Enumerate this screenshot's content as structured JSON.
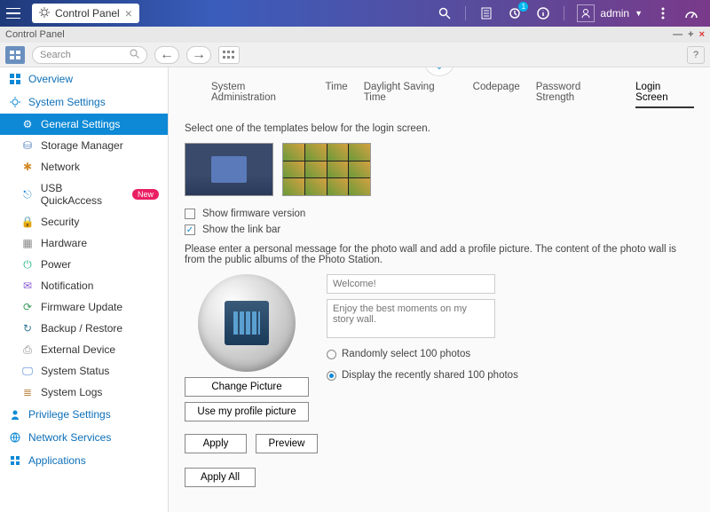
{
  "topbar": {
    "tab_label": "Control Panel",
    "user": "admin",
    "notif_badge": "1"
  },
  "window": {
    "title": "Control Panel"
  },
  "toolbar": {
    "search_placeholder": "Search"
  },
  "sidebar": {
    "cats": [
      {
        "label": "Overview"
      },
      {
        "label": "System Settings",
        "items": [
          {
            "label": "General Settings",
            "active": true
          },
          {
            "label": "Storage Manager"
          },
          {
            "label": "Network"
          },
          {
            "label": "USB QuickAccess",
            "new": "New"
          },
          {
            "label": "Security"
          },
          {
            "label": "Hardware"
          },
          {
            "label": "Power"
          },
          {
            "label": "Notification"
          },
          {
            "label": "Firmware Update"
          },
          {
            "label": "Backup / Restore"
          },
          {
            "label": "External Device"
          },
          {
            "label": "System Status"
          },
          {
            "label": "System Logs"
          }
        ]
      },
      {
        "label": "Privilege Settings"
      },
      {
        "label": "Network Services"
      },
      {
        "label": "Applications"
      }
    ]
  },
  "tabs": {
    "t0": "System Administration",
    "t1": "Time",
    "t2": "Daylight Saving Time",
    "t3": "Codepage",
    "t4": "Password Strength",
    "t5": "Login Screen"
  },
  "content": {
    "template_desc": "Select one of the templates below for the login screen.",
    "check_firmware": "Show firmware version",
    "check_linkbar": "Show the link bar",
    "msg_desc": "Please enter a personal message for the photo wall and add a profile picture. The content of the photo wall is from the public albums of the Photo Station.",
    "welcome_placeholder": "Welcome!",
    "story_placeholder": "Enjoy the best moments on my story wall.",
    "radio_random": "Randomly select 100 photos",
    "radio_recent": "Display the recently shared 100 photos",
    "btn_change": "Change Picture",
    "btn_usemy": "Use my profile picture",
    "btn_apply": "Apply",
    "btn_preview": "Preview",
    "btn_applyall": "Apply All"
  }
}
